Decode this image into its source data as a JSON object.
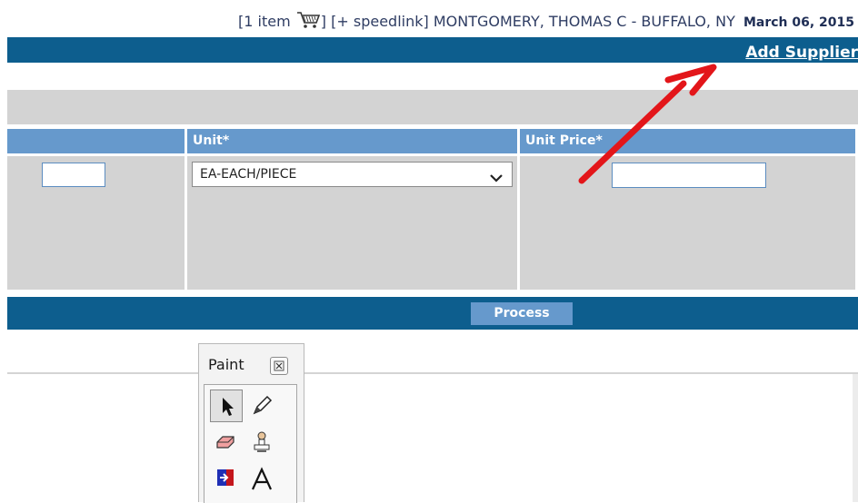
{
  "header": {
    "cart_prefix": "[1 item",
    "cart_suffix": "]",
    "speedlink": "[+ speedlink]",
    "user": "MONTGOMERY, THOMAS C - BUFFALO, NY",
    "date": "March 06, 2015",
    "add_supplier": "Add Supplier"
  },
  "table": {
    "col_unit": "Unit*",
    "col_unit_price": "Unit Price*",
    "unit_selected": "EA-EACH/PIECE"
  },
  "process_label": "Process",
  "paint": {
    "title": "Paint"
  },
  "colors": {
    "dark_blue": "#0d5e8e",
    "light_blue": "#6699cc",
    "gray": "#d3d3d3",
    "annotation_arrow": "#e3161a"
  }
}
